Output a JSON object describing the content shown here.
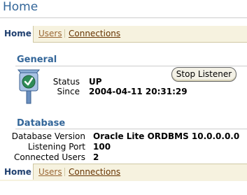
{
  "page": {
    "title": "Home"
  },
  "tabs": [
    {
      "label": "Home",
      "active": true
    },
    {
      "label": "Users",
      "active": false
    },
    {
      "label": "Connections",
      "active": false
    }
  ],
  "general": {
    "heading": "General",
    "status_label": "Status",
    "status_value": "UP",
    "since_label": "Since",
    "since_value": "2004-04-11 20:31:29",
    "stop_button": "Stop Listener",
    "status_icon": "traffic-light-check-icon"
  },
  "database": {
    "heading": "Database",
    "rows": [
      {
        "label": "Database Version",
        "value": "Oracle Lite ORDBMS 10.0.0.0.0"
      },
      {
        "label": "Listening Port",
        "value": "100"
      },
      {
        "label": "Connected Users",
        "value": "2"
      }
    ]
  },
  "colors": {
    "title": "#336699",
    "tab_background": "#f6f2df",
    "link": "#663300",
    "status_ok": "#2e8b57"
  }
}
